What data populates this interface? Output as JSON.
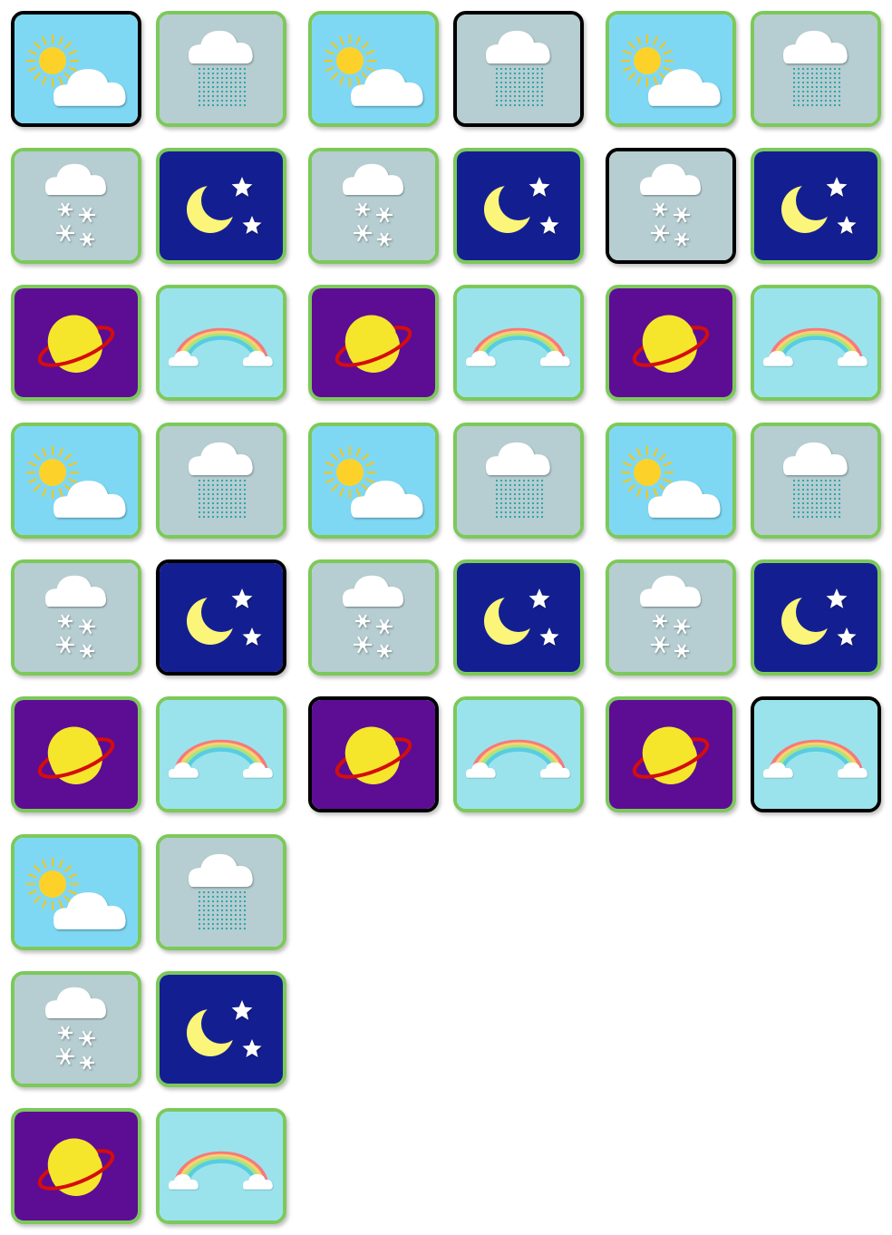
{
  "colors": {
    "border": "#7cc95a",
    "selected_border": "#000000",
    "sun_bg": "#7fd8f3",
    "rain_bg": "#b6cdd1",
    "snow_bg": "#b6cdd1",
    "night_bg": "#131f91",
    "planet_bg": "#5c0d94",
    "rainbow_bg": "#9be3ec"
  },
  "tiles": [
    {
      "icon": "sun-cloud",
      "selected": true
    },
    {
      "icon": "rain",
      "selected": false
    },
    {
      "icon": "sun-cloud",
      "selected": false
    },
    {
      "icon": "rain",
      "selected": true
    },
    {
      "icon": "sun-cloud",
      "selected": false
    },
    {
      "icon": "rain",
      "selected": false
    },
    {
      "icon": "snow",
      "selected": false
    },
    {
      "icon": "night",
      "selected": false
    },
    {
      "icon": "snow",
      "selected": false
    },
    {
      "icon": "night",
      "selected": false
    },
    {
      "icon": "snow",
      "selected": true
    },
    {
      "icon": "night",
      "selected": false
    },
    {
      "icon": "planet",
      "selected": false
    },
    {
      "icon": "rainbow",
      "selected": false
    },
    {
      "icon": "planet",
      "selected": false
    },
    {
      "icon": "rainbow",
      "selected": false
    },
    {
      "icon": "planet",
      "selected": false
    },
    {
      "icon": "rainbow",
      "selected": false
    },
    {
      "icon": "sun-cloud",
      "selected": false
    },
    {
      "icon": "rain",
      "selected": false
    },
    {
      "icon": "sun-cloud",
      "selected": false
    },
    {
      "icon": "rain",
      "selected": false
    },
    {
      "icon": "sun-cloud",
      "selected": false
    },
    {
      "icon": "rain",
      "selected": false
    },
    {
      "icon": "snow",
      "selected": false
    },
    {
      "icon": "night",
      "selected": true
    },
    {
      "icon": "snow",
      "selected": false
    },
    {
      "icon": "night",
      "selected": false
    },
    {
      "icon": "snow",
      "selected": false
    },
    {
      "icon": "night",
      "selected": false
    },
    {
      "icon": "planet",
      "selected": false
    },
    {
      "icon": "rainbow",
      "selected": false
    },
    {
      "icon": "planet",
      "selected": true
    },
    {
      "icon": "rainbow",
      "selected": false
    },
    {
      "icon": "planet",
      "selected": false
    },
    {
      "icon": "rainbow",
      "selected": true
    },
    {
      "icon": "sun-cloud",
      "selected": false
    },
    {
      "icon": "rain",
      "selected": false
    },
    {
      "icon": "snow",
      "selected": false
    },
    {
      "icon": "night",
      "selected": false
    },
    {
      "icon": "planet",
      "selected": false
    },
    {
      "icon": "rainbow",
      "selected": false
    }
  ]
}
